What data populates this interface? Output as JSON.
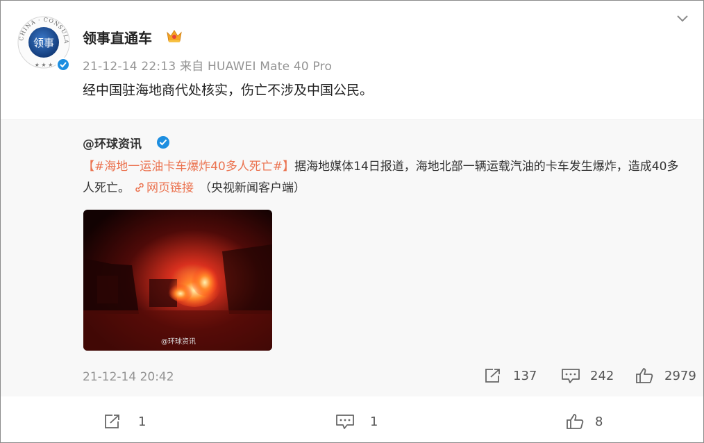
{
  "post": {
    "author": "领事直通车",
    "meta": "21-12-14 22:13  来自 HUAWEI Mate 40 Pro",
    "content": "经中国驻海地商代处核实，伤亡不涉及中国公民。",
    "avatar_seal_text": "CHINA · CONSULAR · AFFAIR",
    "avatar_seal_glyphs": "领事"
  },
  "repost": {
    "author": "@环球资讯",
    "hashtag": "【#海地一运油卡车爆炸40多人死亡#】",
    "text": "据海地媒体14日报道，海地北部一辆运载汽油的卡车发生爆炸，造成40多人死亡。",
    "link_label": "网页链接",
    "source": "（央视新闻客户端）",
    "image_watermark": "@环球资讯",
    "time": "21-12-14 20:42",
    "stats": {
      "reposts": "137",
      "comments": "242",
      "likes": "2979"
    }
  },
  "actions": {
    "reposts": "1",
    "comments": "1",
    "likes": "8"
  },
  "colors": {
    "accent": "#eb7350",
    "verified": "#1d8ee0",
    "meta": "#939393"
  }
}
